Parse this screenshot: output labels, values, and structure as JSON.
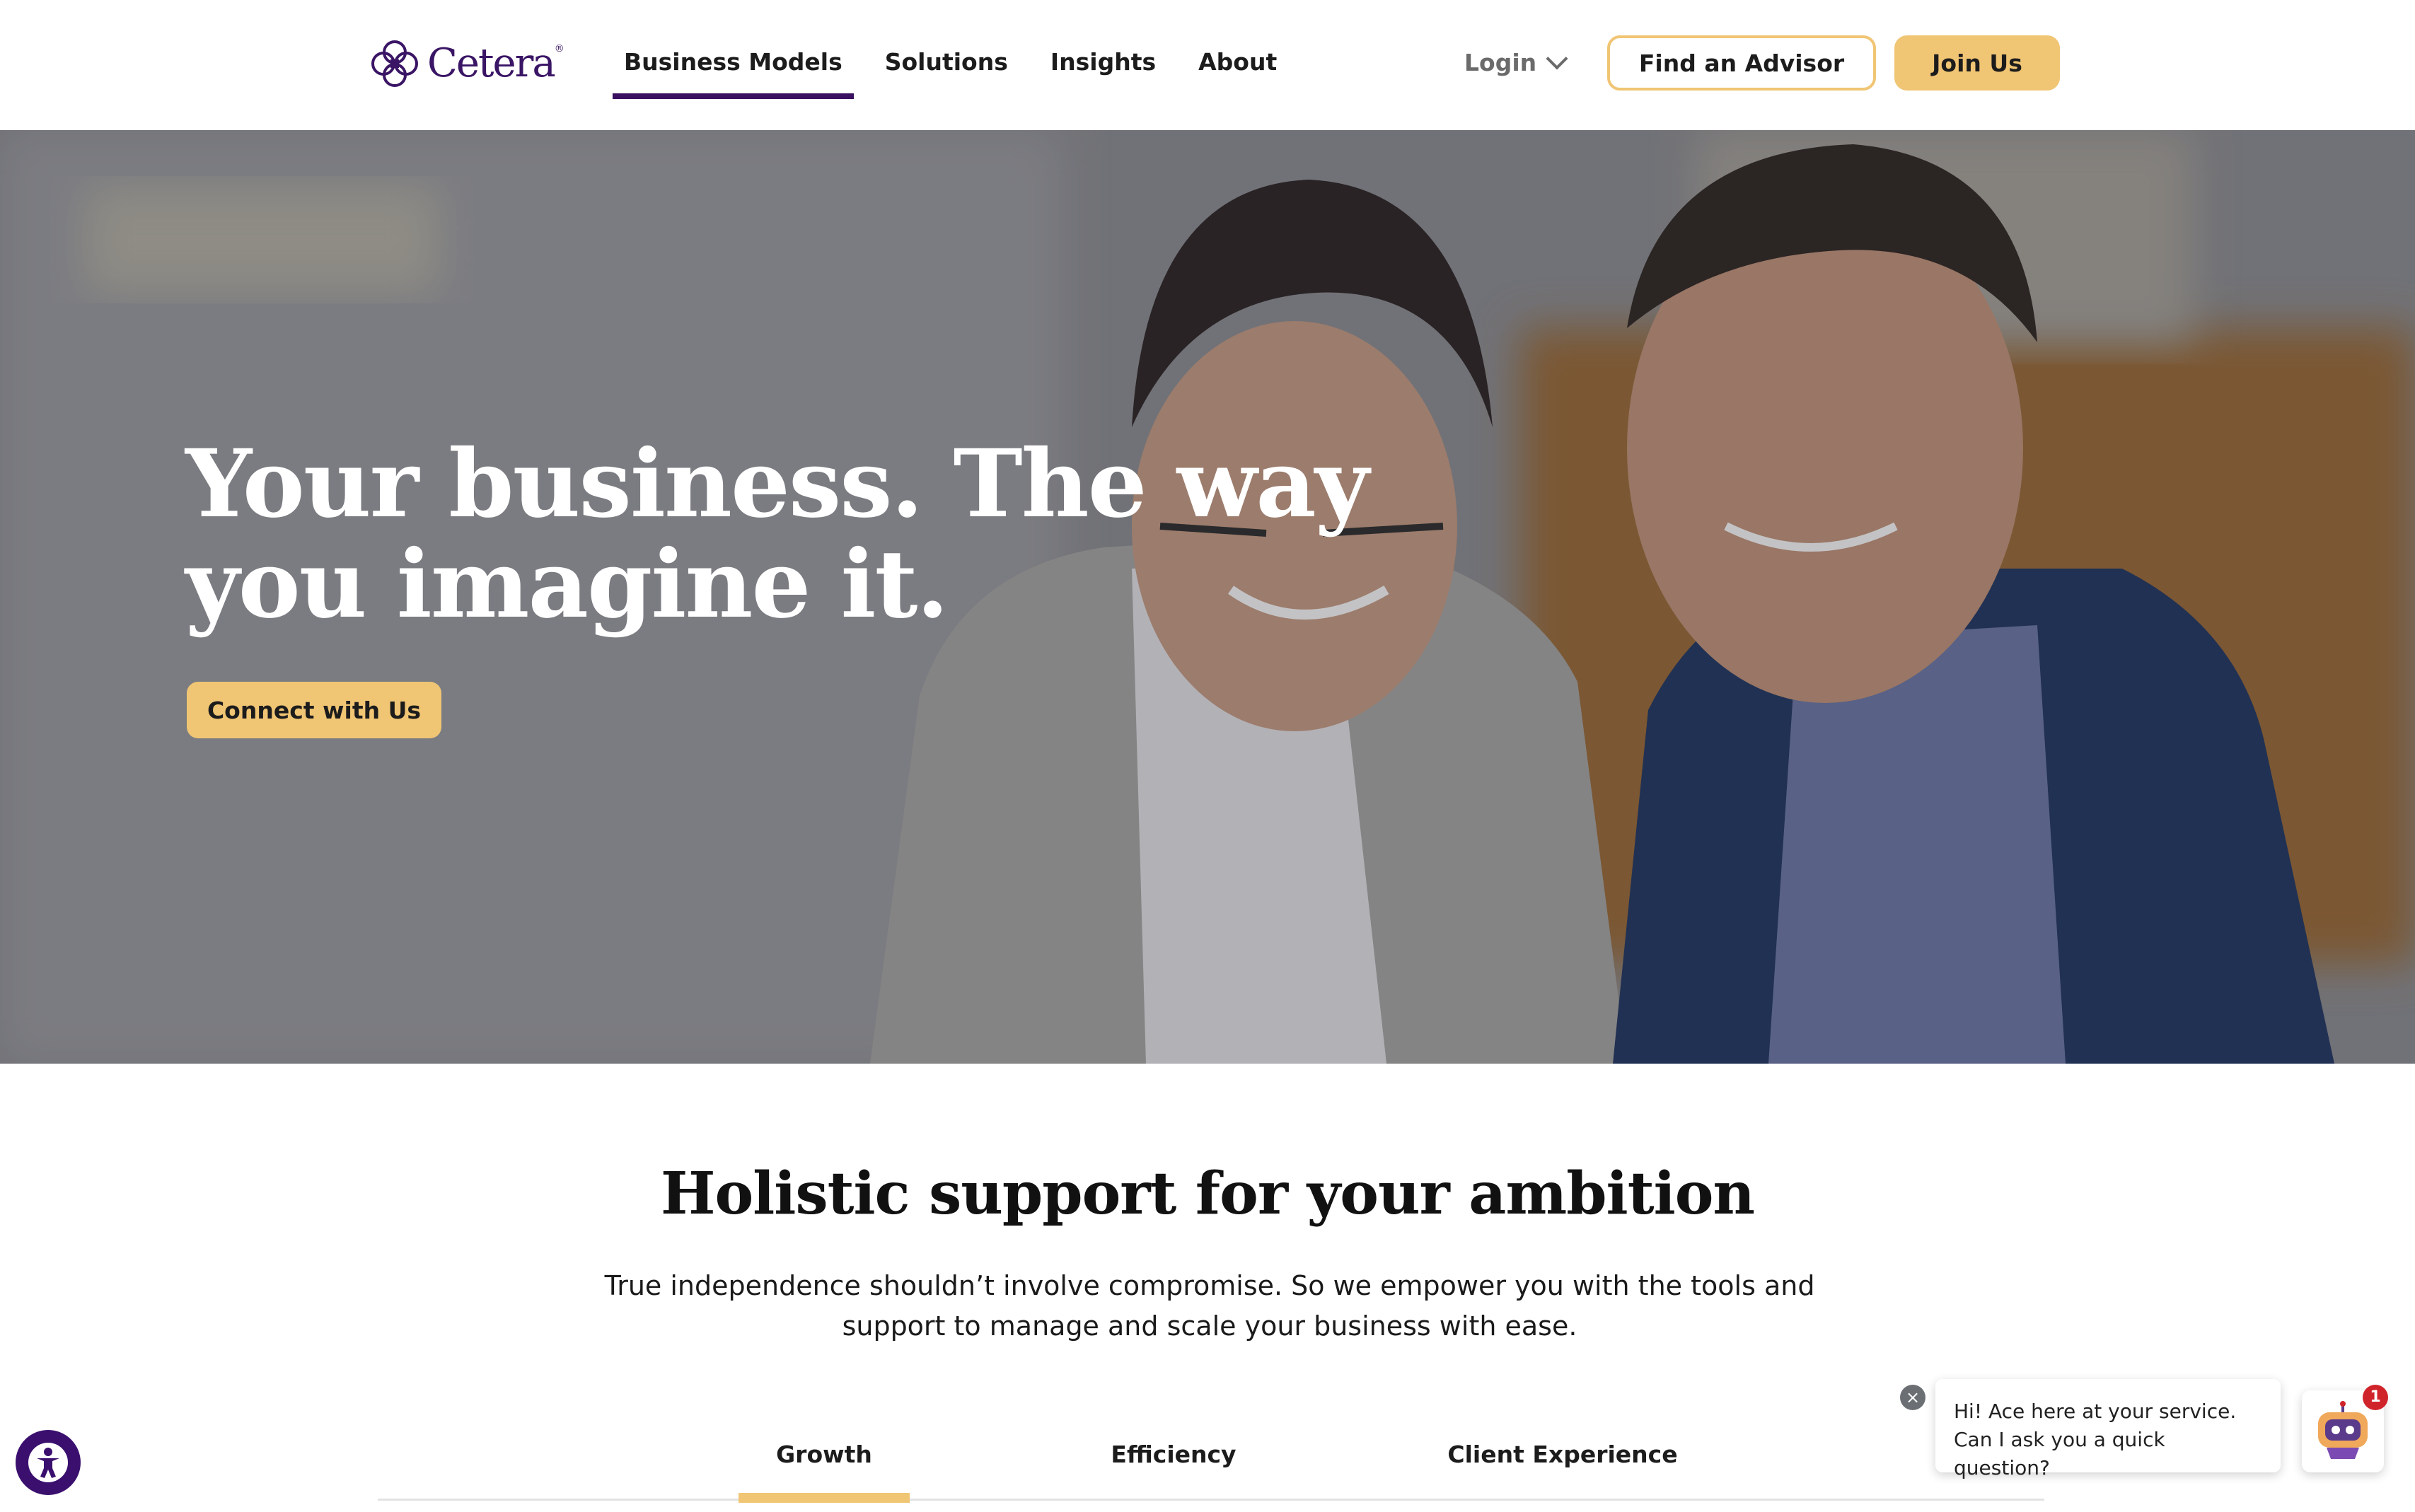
{
  "header": {
    "logo_text": "Cetera",
    "logo_reg": "®",
    "nav": [
      {
        "label": "Business Models",
        "active": true
      },
      {
        "label": "Solutions",
        "active": false
      },
      {
        "label": "Insights",
        "active": false
      },
      {
        "label": "About",
        "active": false
      }
    ],
    "login_label": "Login",
    "advisor_label": "Find an Advisor",
    "join_label": "Join Us"
  },
  "hero": {
    "title": "Your business. The way you imagine it.",
    "cta_label": "Connect with Us"
  },
  "section": {
    "title": "Holistic support for your ambition",
    "body": "True independence shouldn’t involve compromise. So we empower you with the tools and support to manage and scale your business with ease.",
    "tabs": [
      {
        "label": "Growth",
        "active": true
      },
      {
        "label": "Efficiency",
        "active": false
      },
      {
        "label": "Client Experience",
        "active": false
      }
    ]
  },
  "chat": {
    "close_glyph": "×",
    "message": "Hi! Ace here at your service. Can I ask you a quick question?",
    "badge_count": "1"
  },
  "colors": {
    "brand_purple": "#3a1565",
    "accent_gold": "#f0c574",
    "nav_underline": "#3a1060",
    "badge_red": "#d0242b"
  },
  "icons": [
    "cetera-logo-icon",
    "chevron-down-icon",
    "accessibility-icon",
    "close-icon",
    "chatbot-icon"
  ]
}
